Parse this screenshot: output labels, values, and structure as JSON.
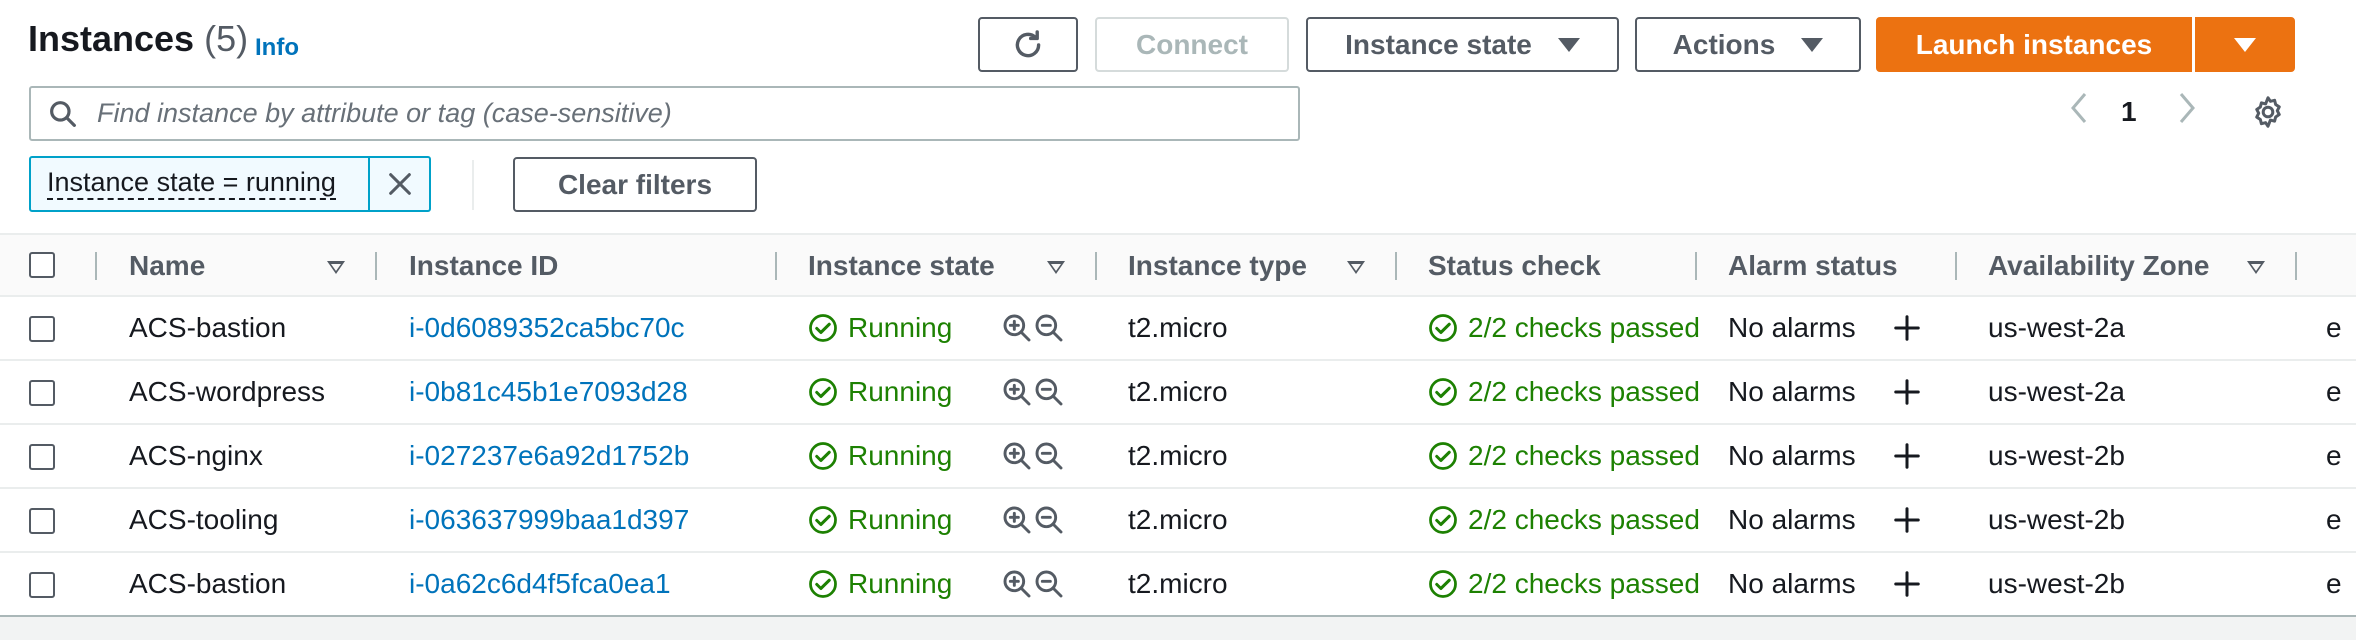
{
  "header": {
    "title": "Instances",
    "count": "(5)",
    "info_label": "Info"
  },
  "toolbar": {
    "refresh_icon": "refresh-icon",
    "connect_label": "Connect",
    "instance_state_label": "Instance state",
    "actions_label": "Actions",
    "launch_label": "Launch instances"
  },
  "search": {
    "placeholder": "Find instance by attribute or tag (case-sensitive)",
    "value": ""
  },
  "pagination": {
    "current_page": "1"
  },
  "filters": {
    "token_label": "Instance state = running",
    "clear_label": "Clear filters"
  },
  "table": {
    "columns": [
      "Name",
      "Instance ID",
      "Instance state",
      "Instance type",
      "Status check",
      "Alarm status",
      "Availability Zone"
    ],
    "rows": [
      {
        "name": "ACS-bastion",
        "instance_id": "i-0d6089352ca5bc70c",
        "state": "Running",
        "type": "t2.micro",
        "status_check": "2/2 checks passed",
        "alarm": "No alarms",
        "az": "us-west-2a",
        "extra": "e"
      },
      {
        "name": "ACS-wordpress",
        "instance_id": "i-0b81c45b1e7093d28",
        "state": "Running",
        "type": "t2.micro",
        "status_check": "2/2 checks passed",
        "alarm": "No alarms",
        "az": "us-west-2a",
        "extra": "e"
      },
      {
        "name": "ACS-nginx",
        "instance_id": "i-027237e6a92d1752b",
        "state": "Running",
        "type": "t2.micro",
        "status_check": "2/2 checks passed",
        "alarm": "No alarms",
        "az": "us-west-2b",
        "extra": "e"
      },
      {
        "name": "ACS-tooling",
        "instance_id": "i-063637999baa1d397",
        "state": "Running",
        "type": "t2.micro",
        "status_check": "2/2 checks passed",
        "alarm": "No alarms",
        "az": "us-west-2b",
        "extra": "e"
      },
      {
        "name": "ACS-bastion",
        "instance_id": "i-0a62c6d4f5fca0ea1",
        "state": "Running",
        "type": "t2.micro",
        "status_check": "2/2 checks passed",
        "alarm": "No alarms",
        "az": "us-west-2b",
        "extra": "e"
      }
    ]
  },
  "colors": {
    "primary": "#ec7211",
    "link": "#0073bb",
    "success": "#1d8102",
    "token_border": "#00a1c9"
  }
}
